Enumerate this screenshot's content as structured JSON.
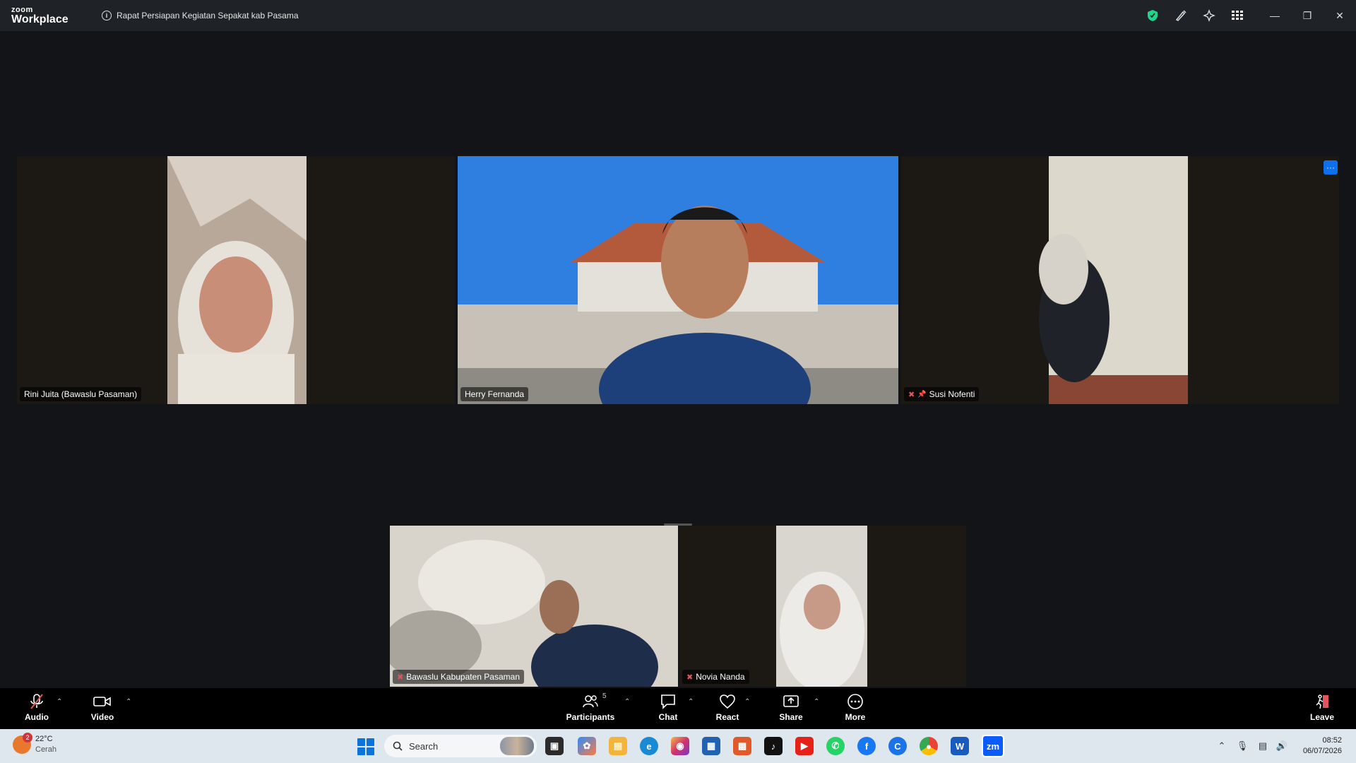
{
  "titlebar": {
    "logo_top": "zoom",
    "logo_bottom": "Workplace",
    "meeting_title": "Rapat Persiapan Kegiatan Sepakat kab Pasama"
  },
  "participants": [
    {
      "name": "Rini Juita (Bawaslu Pasaman)",
      "muted": false
    },
    {
      "name": "Herry Fernanda",
      "muted": false,
      "active": true
    },
    {
      "name": "Susi Nofenti",
      "muted": true,
      "pinned": true
    },
    {
      "name": "Bawaslu Kabupaten Pasaman",
      "muted": true
    },
    {
      "name": "Novia Nanda",
      "muted": true
    }
  ],
  "toolbar": {
    "audio": "Audio",
    "video": "Video",
    "participants": "Participants",
    "participants_count": "5",
    "chat": "Chat",
    "react": "React",
    "share": "Share",
    "more": "More",
    "leave": "Leave"
  },
  "taskbar": {
    "weather_badge": "2",
    "temperature": "22°C",
    "condition": "Cerah",
    "search_placeholder": "Search",
    "time": "08:52",
    "date": "06/07/2026"
  },
  "colors": {
    "active_speaker": "#20d489",
    "muted": "#e0555f",
    "accent": "#0e71eb"
  }
}
